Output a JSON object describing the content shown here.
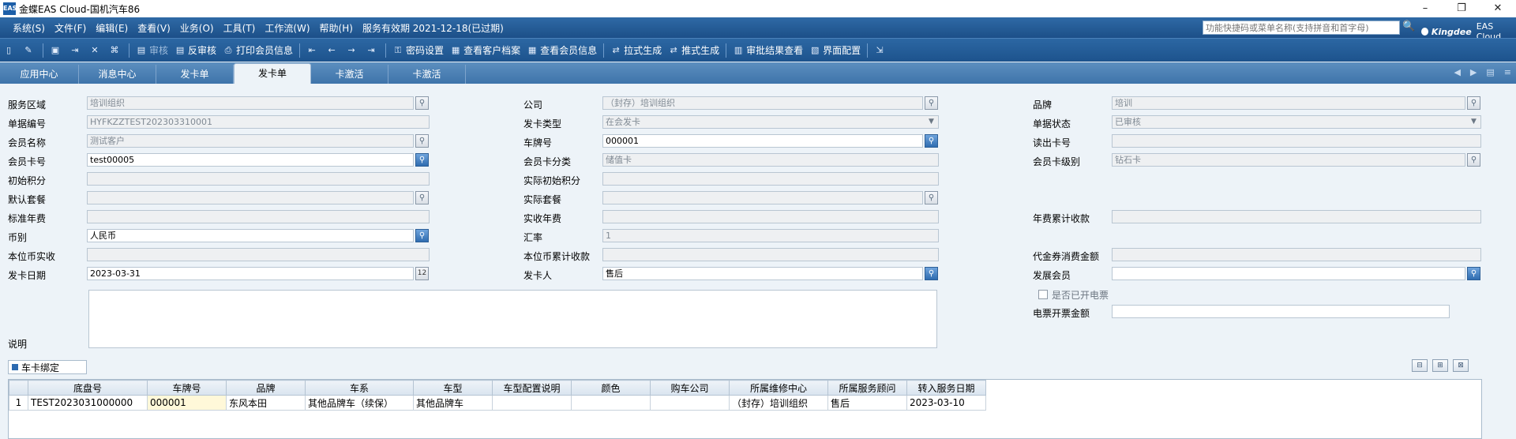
{
  "window": {
    "title": "金蝶EAS Cloud-国机汽车86",
    "logo_text": "EAS",
    "buttons": {
      "minimize": "–",
      "restore": "❐",
      "close": "✕"
    }
  },
  "menubar": {
    "items": [
      "系统(S)",
      "文件(F)",
      "编辑(E)",
      "查看(V)",
      "业务(O)",
      "工具(T)",
      "工作流(W)",
      "帮助(H)"
    ],
    "service_text": "服务有效期 2021-12-18(已过期)",
    "search_placeholder": "功能快捷码或菜单名称(支持拼音和首字母)",
    "brand": "Kingdee",
    "brand_product": "EAS Cloud"
  },
  "toolbar": {
    "buttons": [
      {
        "icon": "new-icon",
        "glyph": "▯",
        "label": ""
      },
      {
        "icon": "edit-icon",
        "glyph": "✎",
        "label": ""
      },
      {
        "icon": "save-icon",
        "glyph": "▣",
        "label": ""
      },
      {
        "icon": "submit-icon",
        "glyph": "⇥",
        "label": ""
      },
      {
        "icon": "delete-icon",
        "glyph": "✕",
        "label": ""
      },
      {
        "icon": "attachment-icon",
        "glyph": "⌘",
        "label": ""
      },
      {
        "icon": "audit-icon",
        "glyph": "▤",
        "label": "审核"
      },
      {
        "icon": "unaudit-icon",
        "glyph": "▤",
        "label": "反审核"
      },
      {
        "icon": "print-icon",
        "glyph": "⎙",
        "label": "打印会员信息"
      },
      {
        "icon": "first-icon",
        "glyph": "⇤",
        "label": ""
      },
      {
        "icon": "prev-icon",
        "glyph": "←",
        "label": ""
      },
      {
        "icon": "next-icon",
        "glyph": "→",
        "label": ""
      },
      {
        "icon": "last-icon",
        "glyph": "⇥",
        "label": ""
      },
      {
        "icon": "password-icon",
        "glyph": "⚿",
        "label": "密码设置"
      },
      {
        "icon": "customer-file-icon",
        "glyph": "▦",
        "label": "查看客户档案"
      },
      {
        "icon": "member-info-icon",
        "glyph": "▦",
        "label": "查看会员信息"
      },
      {
        "icon": "pull-generate-icon",
        "glyph": "⇄",
        "label": "拉式生成"
      },
      {
        "icon": "push-generate-icon",
        "glyph": "⇄",
        "label": "推式生成"
      },
      {
        "icon": "approval-result-icon",
        "glyph": "▥",
        "label": "审批结果查看"
      },
      {
        "icon": "ui-config-icon",
        "glyph": "▧",
        "label": "界面配置"
      },
      {
        "icon": "exit-icon",
        "glyph": "⇲",
        "label": ""
      }
    ]
  },
  "tabs": [
    "应用中心",
    "消息中心",
    "发卡单",
    "发卡单",
    "卡激活",
    "卡激活"
  ],
  "tab_nav": [
    "◀",
    "▶",
    "▤",
    "≡"
  ],
  "form": {
    "service_area": {
      "label": "服务区域",
      "value": "培训组织"
    },
    "company": {
      "label": "公司",
      "value": "（封存）培训组织"
    },
    "brand": {
      "label": "品牌",
      "value": "培训"
    },
    "bill_no": {
      "label": "单据编号",
      "value": "HYFKZZTEST202303310001"
    },
    "card_issue_type": {
      "label": "发卡类型",
      "value": "在会发卡"
    },
    "bill_status": {
      "label": "单据状态",
      "value": "已审核"
    },
    "member_name": {
      "label": "会员名称",
      "value": "测试客户"
    },
    "plate_no": {
      "label": "车牌号",
      "value": "000001"
    },
    "read_card_no": {
      "label": "读出卡号",
      "value": ""
    },
    "member_card_no": {
      "label": "会员卡号",
      "value": "test00005"
    },
    "card_category": {
      "label": "会员卡分类",
      "value": "储值卡"
    },
    "card_level": {
      "label": "会员卡级别",
      "value": "钻石卡"
    },
    "initial_points": {
      "label": "初始积分",
      "value": ""
    },
    "actual_initial_points": {
      "label": "实际初始积分",
      "value": ""
    },
    "default_package": {
      "label": "默认套餐",
      "value": ""
    },
    "actual_package": {
      "label": "实际套餐",
      "value": ""
    },
    "standard_fee": {
      "label": "标准年费",
      "value": ""
    },
    "actual_fee": {
      "label": "实收年费",
      "value": ""
    },
    "fee_accumulated": {
      "label": "年费累计收款",
      "value": ""
    },
    "currency": {
      "label": "币别",
      "value": "人民币"
    },
    "exchange_rate": {
      "label": "汇率",
      "value": "1"
    },
    "local_actual": {
      "label": "本位币实收",
      "value": ""
    },
    "local_accumulated": {
      "label": "本位币累计收款",
      "value": ""
    },
    "voucher_amount": {
      "label": "代金券消费金额",
      "value": ""
    },
    "issue_date": {
      "label": "发卡日期",
      "value": "2023-03-31"
    },
    "issuer": {
      "label": "发卡人",
      "value": "售后"
    },
    "dev_member": {
      "label": "发展会员",
      "value": ""
    },
    "e_invoice": {
      "label": "是否已开电票"
    },
    "e_invoice_amount": {
      "label": "电票开票金额",
      "value": ""
    },
    "remark": {
      "label": "说明",
      "value": ""
    }
  },
  "grid": {
    "title": "车卡绑定",
    "columns": [
      "底盘号",
      "车牌号",
      "品牌",
      "车系",
      "车型",
      "车型配置说明",
      "颜色",
      "购车公司",
      "所属维修中心",
      "所属服务顾问",
      "转入服务日期"
    ],
    "rows": [
      {
        "index": "1",
        "cells": [
          "TEST2023031000000",
          "000001",
          "东风本田",
          "其他品牌车（续保）",
          "其他品牌车",
          "",
          "",
          "",
          "（封存）培训组织",
          "售后",
          "2023-03-10"
        ]
      }
    ]
  }
}
